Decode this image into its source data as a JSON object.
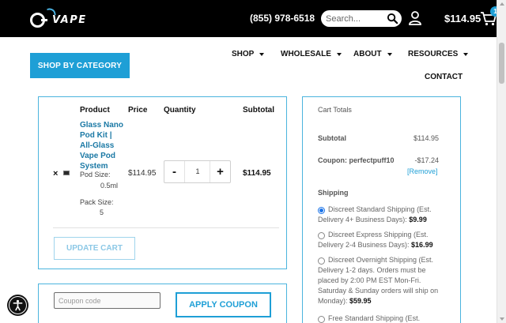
{
  "header": {
    "logo_text": "VAPE",
    "phone": "(855) 978-6518",
    "search_placeholder": "Search...",
    "cart_total": "$114.95",
    "cart_count": "1"
  },
  "nav": {
    "shop_by_category": "SHOP BY CATEGORY",
    "items": [
      {
        "label": "SHOP",
        "has_caret": true
      },
      {
        "label": "WHOLESALE",
        "has_caret": true
      },
      {
        "label": "ABOUT",
        "has_caret": true
      },
      {
        "label": "RESOURCES",
        "has_caret": true
      },
      {
        "label": "CONTACT",
        "has_caret": false
      }
    ]
  },
  "cart_table": {
    "headers": {
      "product": "Product",
      "price": "Price",
      "quantity": "Quantity",
      "subtotal": "Subtotal"
    },
    "remove_symbol": "×",
    "item": {
      "name_lines": [
        "Glass Nano",
        "Pod Kit |",
        "All-Glass",
        "Vape Pod",
        "System"
      ],
      "pod_size_label": "Pod Size:",
      "pod_size_value": "0.5ml",
      "pack_size_label": "Pack Size:",
      "pack_size_value": "5",
      "price": "$114.95",
      "quantity": "1",
      "minus": "-",
      "plus": "+",
      "subtotal": "$114.95"
    },
    "update_cart": "UPDATE CART"
  },
  "coupon": {
    "placeholder": "Coupon code",
    "apply": "APPLY COUPON"
  },
  "totals": {
    "title": "Cart Totals",
    "subtotal_label": "Subtotal",
    "subtotal_value": "$114.95",
    "coupon_label": "Coupon: perfectpuff10",
    "coupon_value": "-$17.24",
    "remove_link": "[Remove]",
    "shipping_label": "Shipping",
    "shipping_options": [
      {
        "lines": [
          "Discreet Standard Shipping (Est.",
          "Delivery 4+ Business Days): "
        ],
        "price": "$9.99",
        "selected": true
      },
      {
        "lines": [
          "Discreet Express Shipping (Est.",
          "Delivery 2-4 Business Days): "
        ],
        "price": "$16.99",
        "selected": false
      },
      {
        "lines": [
          "Discreet Overnight Shipping (Est.",
          "Delivery 1-2 days. Orders must be",
          "placed by 2:00 PM EST Mon-Fri.",
          "Saturday & Sunday orders will ship on",
          "Monday): "
        ],
        "price": "$59.95",
        "selected": false
      },
      {
        "lines": [
          "Free Standard Shipping (Est."
        ],
        "price": "",
        "selected": false
      }
    ]
  },
  "colors": {
    "accent": "#1e9fd6",
    "border": "#4bb4de",
    "topbar": "#000000",
    "link": "#1b79a5"
  }
}
